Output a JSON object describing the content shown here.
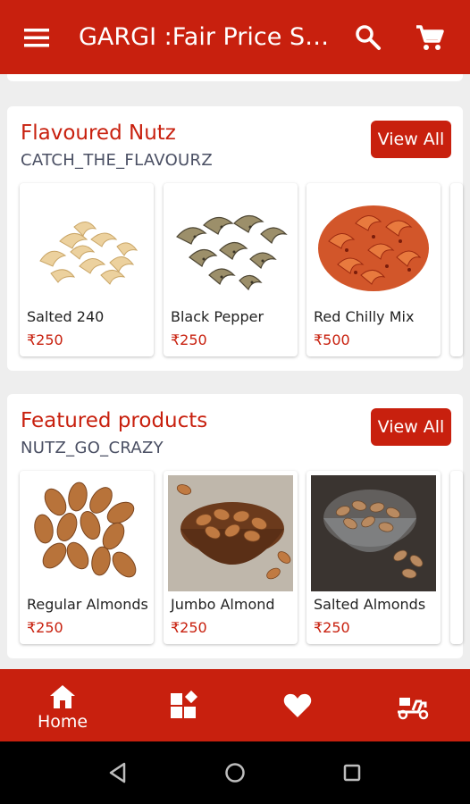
{
  "app": {
    "title": "GARGI :Fair Price Store",
    "accent_color": "#c8200e",
    "icons": {
      "menu": "menu-icon",
      "search": "search-icon",
      "cart": "cart-icon"
    }
  },
  "sections": [
    {
      "title": "Flavoured Nutz",
      "subtitle": "CATCH_THE_FLAVOURZ",
      "view_all_label": "View All",
      "products": [
        {
          "name": "Salted 240",
          "price": "₹250",
          "image": "salted-cashews"
        },
        {
          "name": "Black Pepper",
          "price": "₹250",
          "image": "black-pepper-cashews"
        },
        {
          "name": "Red Chilly Mix",
          "price": "₹500",
          "image": "red-chilly-cashews"
        }
      ]
    },
    {
      "title": "Featured products",
      "subtitle": "NUTZ_GO_CRAZY",
      "view_all_label": "View All",
      "products": [
        {
          "name": "Regular Almonds",
          "price": "₹250",
          "image": "almonds"
        },
        {
          "name": "Jumbo Almond",
          "price": "₹250",
          "image": "almonds-bowl"
        },
        {
          "name": "Salted Almonds",
          "price": "₹250",
          "image": "almonds-glass-bowl"
        }
      ]
    }
  ],
  "bottom_nav": {
    "home_label": "Home",
    "icons": [
      "home-icon",
      "category-icon",
      "heart-icon",
      "delivery-icon"
    ]
  }
}
